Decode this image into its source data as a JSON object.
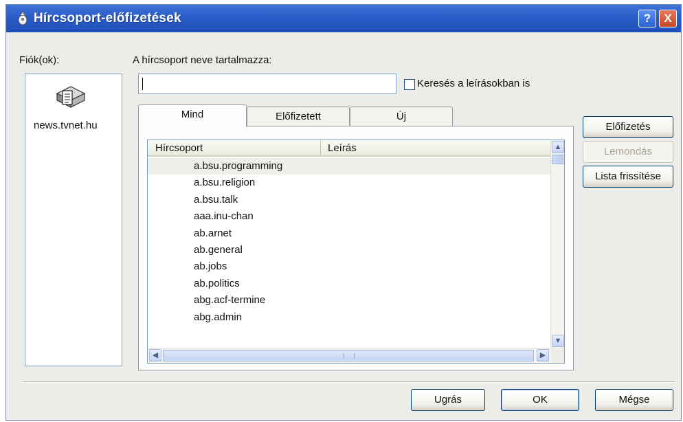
{
  "window": {
    "title": "Hírcsoport-előfizetések",
    "help_label": "?",
    "close_label": "X"
  },
  "accounts": {
    "label": "Fiók(ok):",
    "items": [
      {
        "name": "news.tvnet.hu",
        "icon": "news-server-icon"
      }
    ]
  },
  "search": {
    "label": "A hírcsoport neve tartalmazza:",
    "value": "",
    "include_descriptions_label": "Keresés a leírásokban is",
    "include_descriptions_checked": false
  },
  "tabs": [
    {
      "label": "Mind",
      "active": true
    },
    {
      "label": "Előfizetett",
      "active": false
    },
    {
      "label": "Új",
      "active": false
    }
  ],
  "list": {
    "columns": [
      "Hírcsoport",
      "Leírás"
    ],
    "rows": [
      {
        "name": "a.bsu.programming",
        "description": ""
      },
      {
        "name": "a.bsu.religion",
        "description": ""
      },
      {
        "name": "a.bsu.talk",
        "description": ""
      },
      {
        "name": "aaa.inu-chan",
        "description": ""
      },
      {
        "name": "ab.arnet",
        "description": ""
      },
      {
        "name": "ab.general",
        "description": ""
      },
      {
        "name": "ab.jobs",
        "description": ""
      },
      {
        "name": "ab.politics",
        "description": ""
      },
      {
        "name": "abg.acf-termine",
        "description": ""
      },
      {
        "name": "abg.admin",
        "description": ""
      }
    ],
    "selected_row": 0
  },
  "side_buttons": {
    "subscribe": "Előfizetés",
    "unsubscribe": "Lemondás",
    "refresh": "Lista frissítése"
  },
  "footer_buttons": {
    "goto": "Ugrás",
    "ok": "OK",
    "cancel": "Mégse"
  },
  "colors": {
    "titlebar": "#2a5cc8",
    "dialog_bg": "#ecece8",
    "button_border": "#003c74"
  }
}
